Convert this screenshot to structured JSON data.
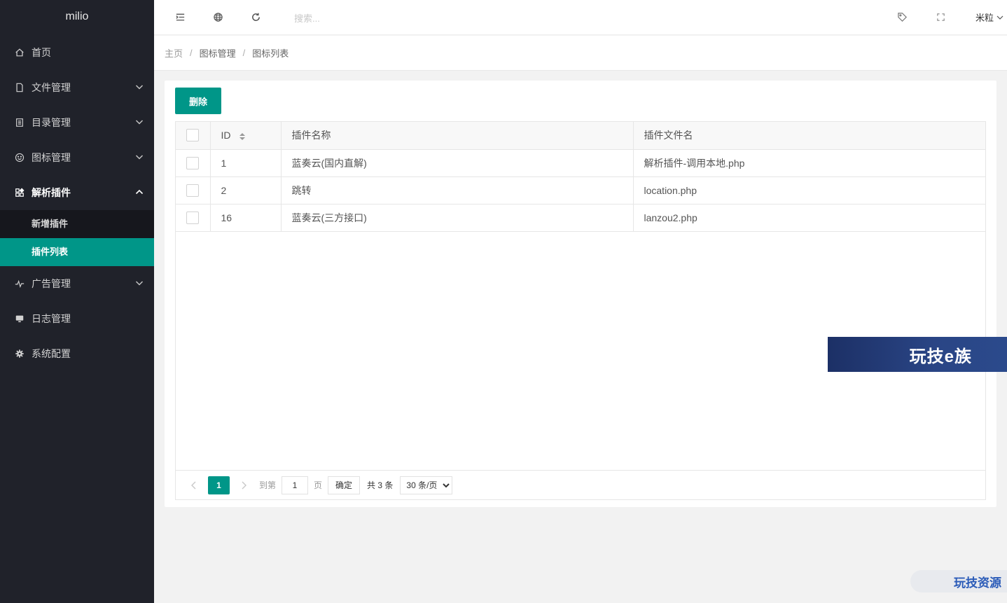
{
  "app": {
    "name": "milio"
  },
  "sidebar": {
    "items": [
      {
        "label": "首页",
        "icon": "home-icon"
      },
      {
        "label": "文件管理",
        "icon": "file-icon"
      },
      {
        "label": "目录管理",
        "icon": "list-icon"
      },
      {
        "label": "图标管理",
        "icon": "smile-icon"
      },
      {
        "label": "解析插件",
        "icon": "apps-icon"
      },
      {
        "label": "广告管理",
        "icon": "pulse-icon"
      },
      {
        "label": "日志管理",
        "icon": "monitor-icon"
      },
      {
        "label": "系统配置",
        "icon": "gear-icon"
      }
    ],
    "sub_items": [
      {
        "label": "新增插件"
      },
      {
        "label": "插件列表"
      }
    ]
  },
  "header": {
    "search_placeholder": "搜索...",
    "user": "米粒"
  },
  "breadcrumb": [
    "主页",
    "图标管理",
    "图标列表"
  ],
  "toolbar": {
    "delete_label": "删除"
  },
  "table": {
    "columns": [
      "ID",
      "插件名称",
      "插件文件名"
    ],
    "rows": [
      {
        "id": "1",
        "name": "蓝奏云(国内直解)",
        "file": "解析插件-调用本地.php"
      },
      {
        "id": "2",
        "name": "跳转",
        "file": "location.php"
      },
      {
        "id": "16",
        "name": "蓝奏云(三方接口)",
        "file": "lanzou2.php"
      }
    ]
  },
  "pager": {
    "current": "1",
    "goto_label": "到第",
    "goto_value": "1",
    "page_label": "页",
    "ok_label": "确定",
    "total": "共 3 条",
    "per_page": "30 条/页"
  },
  "watermarks": {
    "banner": "玩技e族",
    "corner": "玩技资源"
  },
  "colors": {
    "accent": "#009688",
    "sidebar": "#20222a"
  }
}
